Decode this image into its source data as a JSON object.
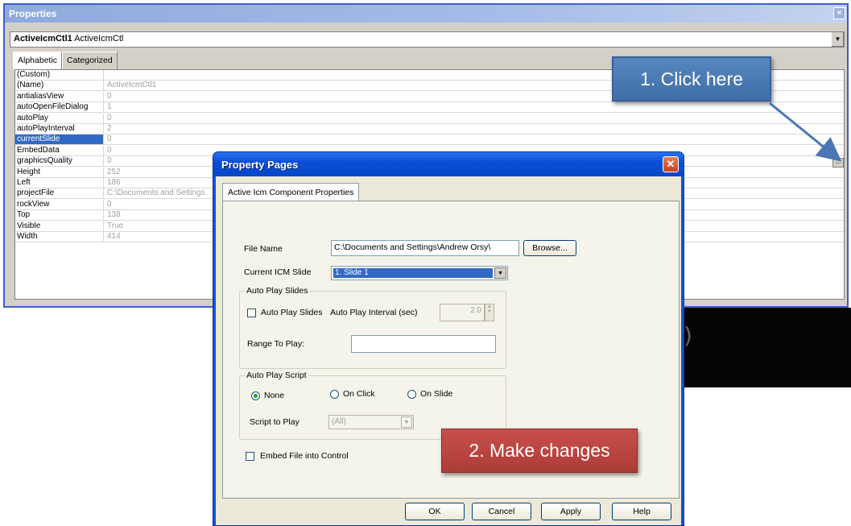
{
  "properties_window": {
    "title": "Properties",
    "close_glyph": "×",
    "object_name": "ActiveIcmCtl1",
    "object_type": "ActiveIcmCtl",
    "tabs": [
      "Alphabetic",
      "Categorized"
    ],
    "rows": [
      {
        "name": "(Custom)",
        "value": ""
      },
      {
        "name": "(Name)",
        "value": "ActiveIcmCtl1"
      },
      {
        "name": "antialiasView",
        "value": "0"
      },
      {
        "name": "autoOpenFileDialog",
        "value": "1"
      },
      {
        "name": "autoPlay",
        "value": "0"
      },
      {
        "name": "autoPlayInterval",
        "value": "2"
      },
      {
        "name": "currentSlide",
        "value": "0",
        "selected": true
      },
      {
        "name": "EmbedData",
        "value": "0"
      },
      {
        "name": "graphicsQuality",
        "value": "0"
      },
      {
        "name": "Height",
        "value": "252"
      },
      {
        "name": "Left",
        "value": "186"
      },
      {
        "name": "projectFile",
        "value": "C:\\Documents and Settings"
      },
      {
        "name": "rockView",
        "value": "0"
      },
      {
        "name": "Top",
        "value": "138"
      },
      {
        "name": "Visible",
        "value": "True"
      },
      {
        "name": "Width",
        "value": "414"
      }
    ],
    "ellipsis_label": "..."
  },
  "callouts": {
    "click_here": "1. Click here",
    "make_changes": "2. Make changes",
    "arrow_color": "#4a76b5"
  },
  "property_pages": {
    "title": "Property Pages",
    "close_glyph": "✕",
    "tab_label": "Active Icm Component Properties",
    "file_name_label": "File Name",
    "file_name_value": "C:\\Documents and Settings\\Andrew Orsy\\",
    "browse_label": "Browse...",
    "current_slide_label": "Current ICM Slide",
    "current_slide_value": "1. Slide 1",
    "auto_play_group": "Auto Play Slides",
    "auto_play_checkbox": "Auto Play Slides",
    "auto_play_interval_label": "Auto Play Interval (sec)",
    "auto_play_interval_value": "2.0",
    "range_to_play_label": "Range To Play:",
    "range_to_play_value": "",
    "auto_play_script_group": "Auto Play Script",
    "radio_none": "None",
    "radio_on_click": "On Click",
    "radio_on_slide": "On Slide",
    "script_to_play_label": "Script to Play",
    "script_to_play_value": "(All)",
    "embed_checkbox": "Embed File into Control",
    "ok_label": "OK",
    "cancel_label": "Cancel",
    "apply_label": "Apply",
    "help_label": "Help"
  },
  "colors": {
    "xp_blue": "#0b55d9",
    "selection": "#316ac5",
    "callout_blue": "#4a7ab8",
    "callout_red": "#bd4742"
  }
}
